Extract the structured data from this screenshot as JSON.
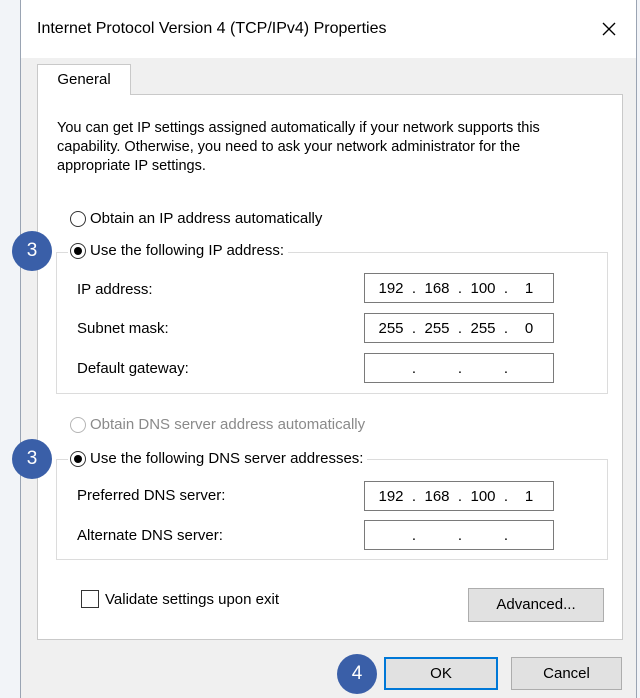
{
  "window": {
    "title": "Internet Protocol Version 4 (TCP/IPv4) Properties",
    "close_glyph": "✕"
  },
  "tabs": [
    {
      "label": "General"
    }
  ],
  "intro_text": "You can get IP settings assigned automatically if your network supports this capability. Otherwise, you need to ask your network administrator for the appropriate IP settings.",
  "ip_section": {
    "auto_label": "Obtain an IP address automatically",
    "manual_label": "Use the following IP address:",
    "selected": "manual",
    "fields": [
      {
        "label": "IP address:",
        "octets": [
          "192",
          "168",
          "100",
          "1"
        ]
      },
      {
        "label": "Subnet mask:",
        "octets": [
          "255",
          "255",
          "255",
          "0"
        ]
      },
      {
        "label": "Default gateway:",
        "octets": [
          "",
          "",
          "",
          ""
        ]
      }
    ]
  },
  "dns_section": {
    "auto_label": "Obtain DNS server address automatically",
    "manual_label": "Use the following DNS server addresses:",
    "selected": "manual",
    "fields": [
      {
        "label": "Preferred DNS server:",
        "octets": [
          "192",
          "168",
          "100",
          "1"
        ]
      },
      {
        "label": "Alternate DNS server:",
        "octets": [
          "",
          "",
          "",
          ""
        ]
      }
    ]
  },
  "validate_label": "Validate settings upon exit",
  "validate_checked": false,
  "buttons": {
    "advanced": "Advanced...",
    "ok": "OK",
    "cancel": "Cancel"
  },
  "badges": {
    "ip_step": "3",
    "dns_step": "3",
    "ok_step": "4"
  },
  "colors": {
    "badge": "#3a5fa8",
    "focus": "#0078d7"
  },
  "icons": {
    "close": "close-icon",
    "radio": "radio-icon",
    "checkbox": "checkbox-icon"
  }
}
